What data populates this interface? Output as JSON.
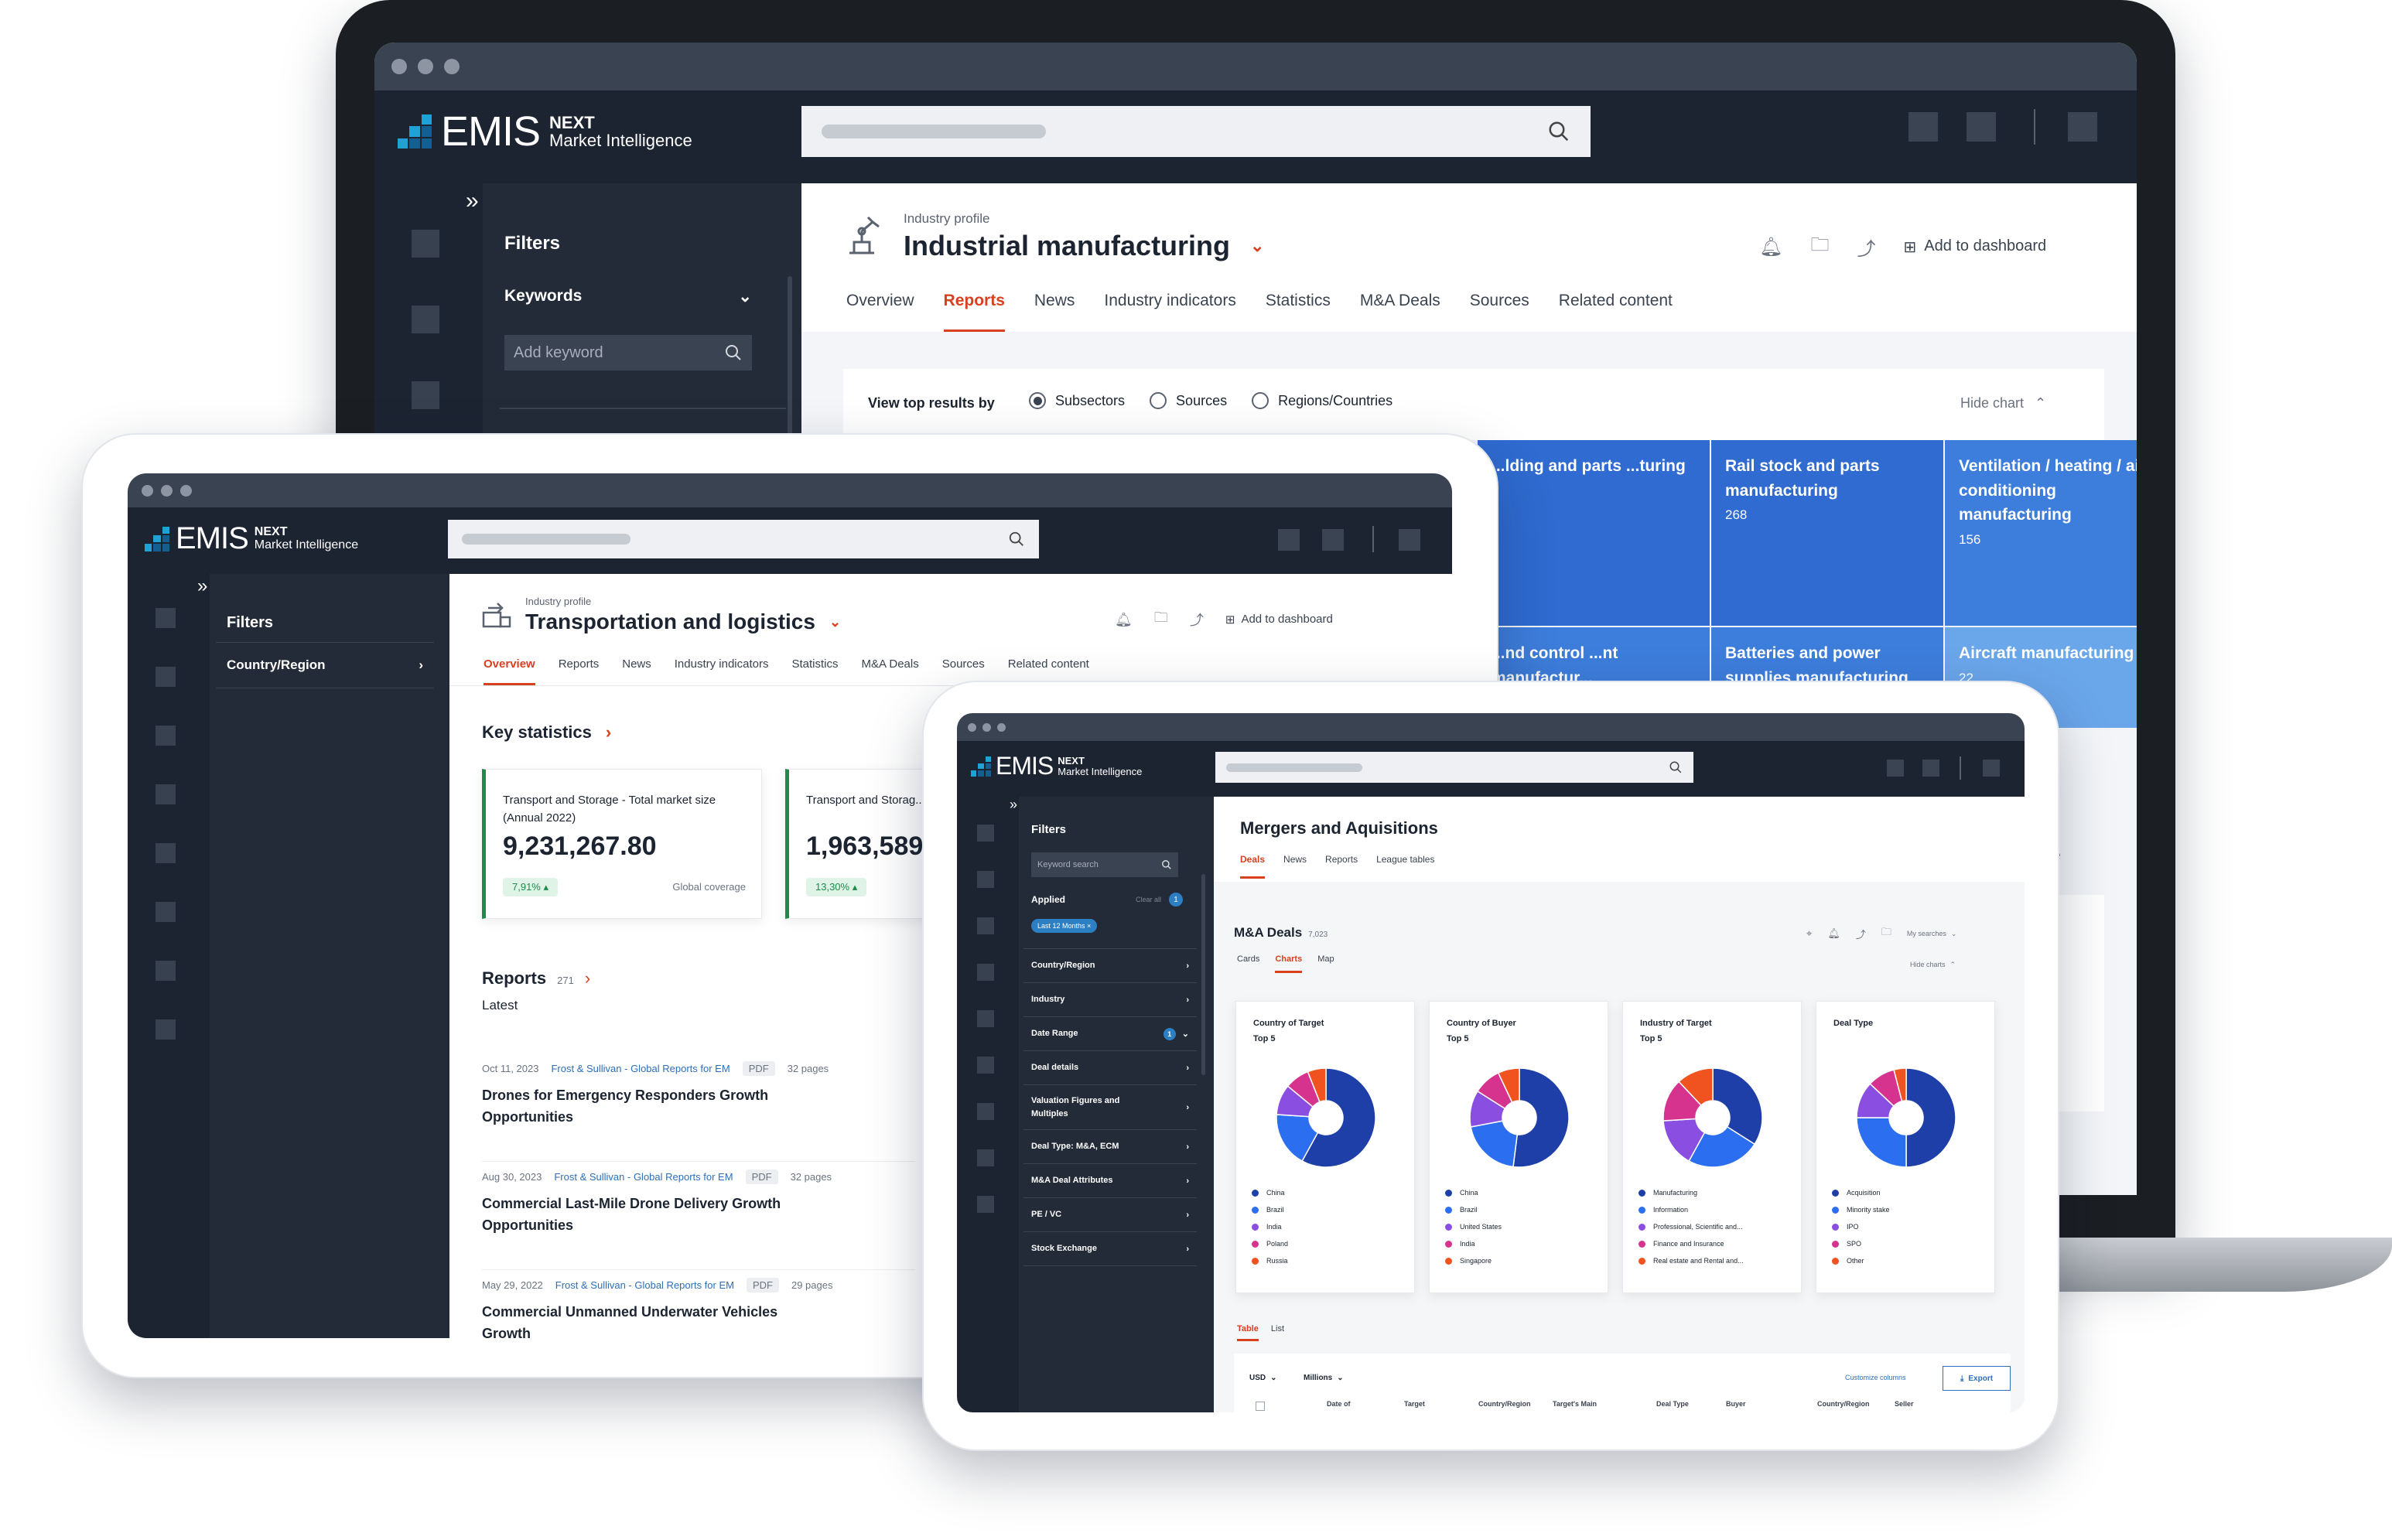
{
  "brand": {
    "logo_word": "EMIS",
    "logo_top": "NEXT",
    "logo_bottom": "Market Intelligence"
  },
  "laptop": {
    "filters_title": "Filters",
    "keywords_label": "Keywords",
    "keyword_placeholder": "Add keyword",
    "profile_kicker": "Industry profile",
    "profile_title": "Industrial manufacturing",
    "add_dashboard": "Add to dashboard",
    "tabs": [
      "Overview",
      "Reports",
      "News",
      "Industry indicators",
      "Statistics",
      "M&A Deals",
      "Sources",
      "Related content"
    ],
    "active_tab": "Reports",
    "view_by_label": "View top results by",
    "radios": [
      "Subsectors",
      "Sources",
      "Regions/Countries"
    ],
    "hide_chart": "Hide chart",
    "tiles": [
      {
        "title": "...lding and parts ...turing",
        "count": ""
      },
      {
        "title": "Rail stock and parts manufacturing",
        "count": "268"
      },
      {
        "title": "Ventilation / heating / air conditioning manufacturing",
        "count": "156"
      },
      {
        "title": "...nd control ...nt manufactur...",
        "count": ""
      },
      {
        "title": "Batteries and power supplies manufacturing",
        "count": ""
      },
      {
        "title": "Aircraft manufacturing",
        "count": "22"
      }
    ],
    "peek_text": "ate",
    "colors": {
      "tile_dark": "#2f6bd0",
      "tile_mid": "#3d7ddb",
      "tile_light": "#6aa6ea"
    }
  },
  "tablet": {
    "filters_title": "Filters",
    "country_region": "Country/Region",
    "profile_kicker": "Industry profile",
    "profile_title": "Transportation and logistics",
    "add_dashboard": "Add to dashboard",
    "tabs": [
      "Overview",
      "Reports",
      "News",
      "Industry indicators",
      "Statistics",
      "M&A Deals",
      "Sources",
      "Related content"
    ],
    "active_tab": "Overview",
    "key_stats_title": "Key statistics",
    "stats": [
      {
        "label": "Transport and Storage - Total market size (Annual 2022)",
        "value": "9,231,267.80",
        "change": "7,91%",
        "coverage": "Global coverage"
      },
      {
        "label": "Transport and Storag... (Annual 2022)",
        "value": "1,963,589",
        "change": "13,30%",
        "coverage": ""
      }
    ],
    "reports_title": "Reports",
    "reports_count": "271",
    "latest_label": "Latest",
    "reports": [
      {
        "date": "Oct 11, 2023",
        "source": "Frost & Sullivan - Global Reports for EM",
        "format": "PDF",
        "pages": "32 pages",
        "title": "Drones for Emergency Responders Growth Opportunities"
      },
      {
        "date": "Aug 30, 2023",
        "source": "Frost & Sullivan - Global Reports for EM",
        "format": "PDF",
        "pages": "32 pages",
        "title": "Commercial Last-Mile Drone Delivery Growth Opportunities"
      },
      {
        "date": "May 29, 2022",
        "source": "Frost & Sullivan - Global Reports for EM",
        "format": "PDF",
        "pages": "29 pages",
        "title": "Commercial Unmanned Underwater Vehicles Growth"
      }
    ]
  },
  "phone": {
    "filters_title": "Filters",
    "keyword_placeholder": "Keyword search",
    "applied_label": "Applied",
    "clear_all": "Clear all",
    "applied_count": "1",
    "applied_chip": "Last 12 Months ×",
    "filter_items": [
      {
        "label": "Country/Region",
        "badge": ""
      },
      {
        "label": "Industry",
        "badge": ""
      },
      {
        "label": "Date Range",
        "badge": "1"
      },
      {
        "label": "Deal details",
        "badge": ""
      },
      {
        "label": "Valuation Figures and Multiples",
        "badge": ""
      },
      {
        "label": "Deal Type: M&A, ECM",
        "badge": ""
      },
      {
        "label": "M&A Deal Attributes",
        "badge": ""
      },
      {
        "label": "PE / VC",
        "badge": ""
      },
      {
        "label": "Stock Exchange",
        "badge": ""
      }
    ],
    "page_title": "Mergers and Aquisitions",
    "tabs": [
      "Deals",
      "News",
      "Reports",
      "League tables"
    ],
    "active_tab": "Deals",
    "deals_title": "M&A Deals",
    "deals_count": "7,023",
    "view_tabs": [
      "Cards",
      "Charts",
      "Map"
    ],
    "active_view": "Charts",
    "my_searches": "My searches",
    "hide_charts": "Hide charts",
    "table_tabs": [
      "Table",
      "List"
    ],
    "currency": "USD",
    "unit": "Millions",
    "customize": "Customize columns",
    "export": "Export",
    "columns": [
      "Date of",
      "Target",
      "Country/Region",
      "Target's Main",
      "Deal Type",
      "Buyer",
      "Country/Region",
      "Seller"
    ]
  },
  "chart_data": [
    {
      "type": "pie",
      "title": "Country of Target",
      "subtitle": "Top 5",
      "categories": [
        "China",
        "Brazil",
        "India",
        "Poland",
        "Russia"
      ],
      "values": [
        58,
        18,
        10,
        8,
        6
      ],
      "colors": [
        "#1f3fa8",
        "#2b6ff0",
        "#8a4fe0",
        "#d6338f",
        "#f0531f"
      ]
    },
    {
      "type": "pie",
      "title": "Country of Buyer",
      "subtitle": "Top 5",
      "categories": [
        "China",
        "Brazil",
        "United States",
        "India",
        "Singapore"
      ],
      "values": [
        52,
        20,
        12,
        9,
        7
      ],
      "colors": [
        "#1f3fa8",
        "#2b6ff0",
        "#8a4fe0",
        "#d6338f",
        "#f0531f"
      ]
    },
    {
      "type": "pie",
      "title": "Industry of Target",
      "subtitle": "Top 5",
      "categories": [
        "Manufacturing",
        "Information",
        "Professional, Scientific and...",
        "Finance and Insurance",
        "Real estate and Rental and..."
      ],
      "values": [
        34,
        24,
        16,
        14,
        12
      ],
      "colors": [
        "#1f3fa8",
        "#2b6ff0",
        "#8a4fe0",
        "#d6338f",
        "#f0531f"
      ]
    },
    {
      "type": "pie",
      "title": "Deal Type",
      "subtitle": "",
      "categories": [
        "Acquisition",
        "Minority stake",
        "IPO",
        "SPO",
        "Other"
      ],
      "values": [
        50,
        25,
        12,
        9,
        4
      ],
      "colors": [
        "#1f3fa8",
        "#2b6ff0",
        "#8a4fe0",
        "#d6338f",
        "#f0531f"
      ]
    }
  ]
}
